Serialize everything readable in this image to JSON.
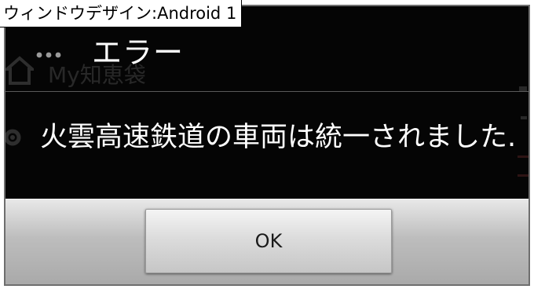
{
  "window_label": "ウィンドウデザイン:Android 1",
  "dialog": {
    "title": "エラー",
    "message": "火雲高速鉄道の車両は統一されました.",
    "ok_label": "OK"
  },
  "background": {
    "partial_text": "My知恵袋"
  },
  "icons": {
    "overflow": "overflow-menu-icon",
    "home": "home-icon",
    "gear": "gear-icon"
  },
  "colors": {
    "dialog_background": "#050505",
    "button_bar": "#bdbdbd",
    "title_text": "#ffffff"
  }
}
